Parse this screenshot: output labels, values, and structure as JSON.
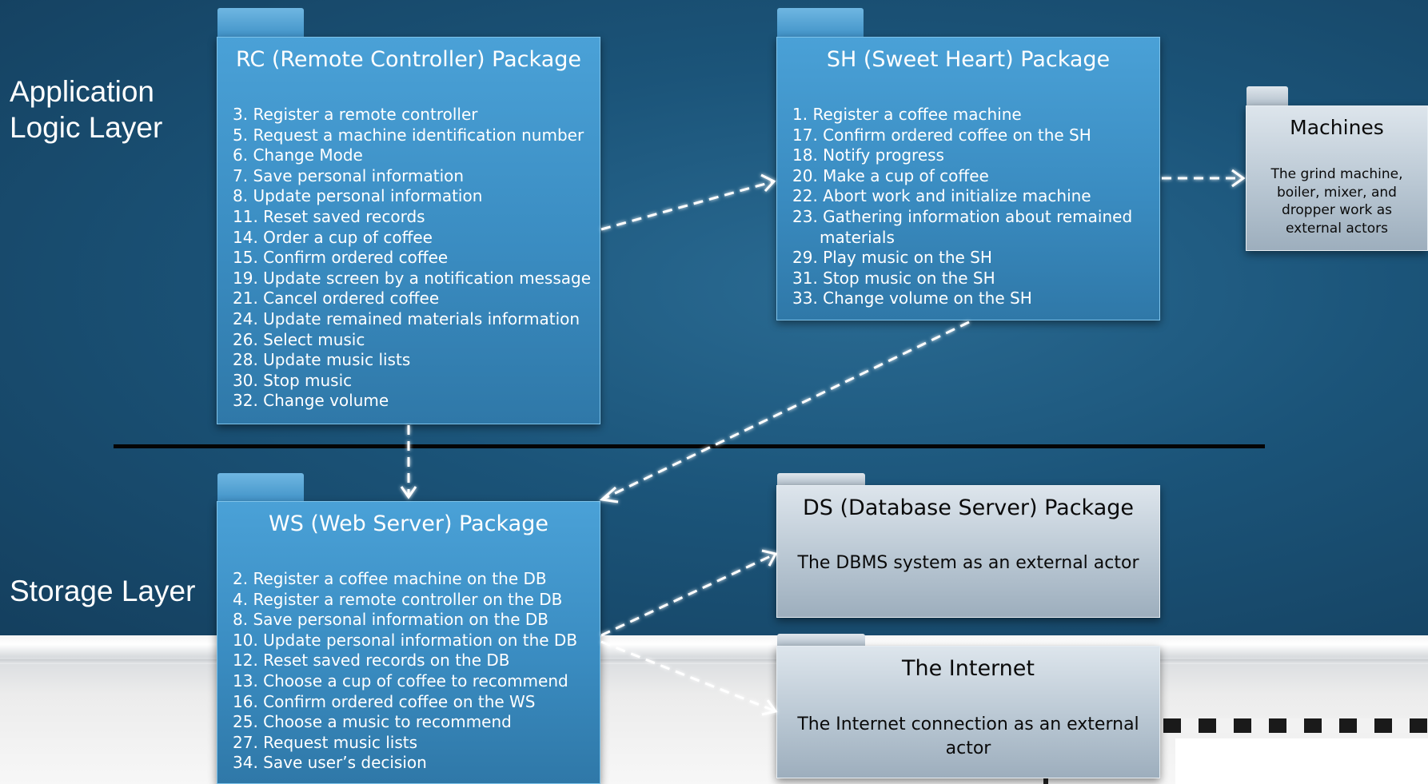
{
  "layers": {
    "application": "Application Logic Layer",
    "storage": "Storage Layer"
  },
  "packages": {
    "rc": {
      "title": "RC (Remote Controller) Package",
      "items": [
        "3. Register a remote controller",
        "5. Request a machine identification number",
        "6. Change Mode",
        "7. Save personal information",
        "8. Update personal information",
        "11. Reset saved records",
        "14. Order a cup of coffee",
        "15. Confirm ordered coffee",
        "19. Update screen by a notification message",
        "21. Cancel ordered coffee",
        "24. Update remained materials information",
        "26. Select music",
        "28. Update music lists",
        "30. Stop music",
        "32. Change volume"
      ]
    },
    "sh": {
      "title": "SH (Sweet Heart) Package",
      "items": [
        "1. Register a coffee machine",
        "17. Confirm ordered coffee on the SH",
        "18. Notify progress",
        "20. Make a cup of coffee",
        "22. Abort work and initialize machine",
        "23. Gathering information about remained materials",
        "29. Play music on the SH",
        "31. Stop music on the SH",
        "33. Change volume on the SH"
      ]
    },
    "machines": {
      "title": "Machines",
      "description": "The grind machine, boiler, mixer, and dropper  work as external actors"
    },
    "ws": {
      "title": "WS (Web Server) Package",
      "items": [
        "2. Register a coffee machine on the DB",
        "4. Register a remote controller on the DB",
        "8. Save personal information on the DB",
        "10. Update personal information on the DB",
        "12. Reset saved records on the DB",
        "13. Choose a cup of coffee to recommend",
        "16. Confirm ordered coffee on the WS",
        "25. Choose a music to recommend",
        "27. Request music lists",
        "34. Save user’s decision"
      ]
    },
    "ds": {
      "title": "DS (Database Server) Package",
      "description": "The DBMS system as an external actor"
    },
    "internet": {
      "title": "The Internet",
      "description": "The Internet connection as an external actor"
    }
  },
  "colors": {
    "background": "#1b5479",
    "package_blue": "#3a8cc1",
    "package_grey": "#b9c7d3",
    "arrow": "#ffffff",
    "divider": "#050505"
  }
}
